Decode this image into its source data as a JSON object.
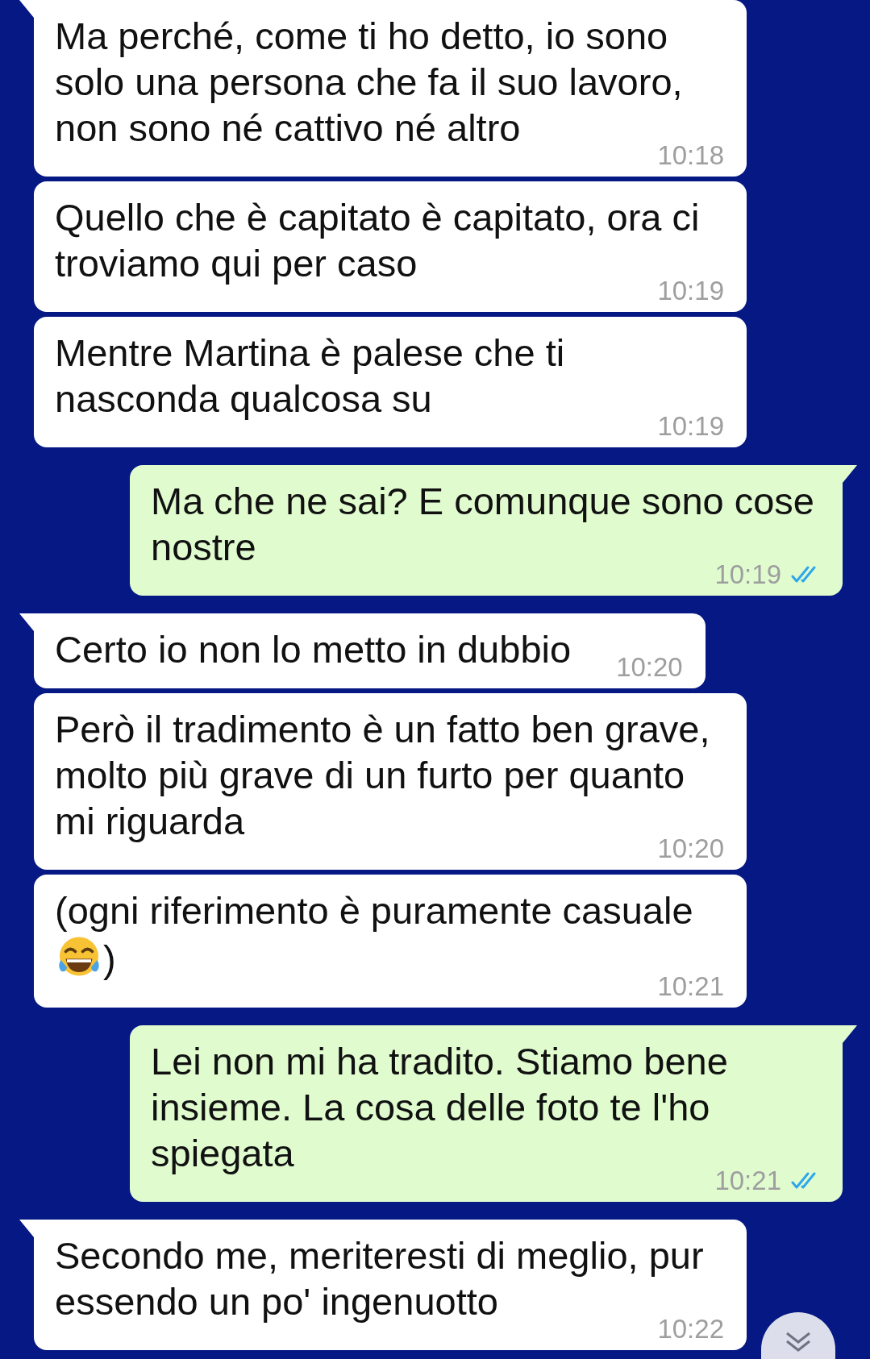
{
  "messages": [
    {
      "kind": "incoming",
      "tail": true,
      "parts": [
        {
          "kind": "text",
          "text": "Ma perché, come ti ho detto, io sono solo una persona che fa il suo lavoro, non sono né cattivo né altro"
        }
      ],
      "time": "10:18"
    },
    {
      "kind": "incoming",
      "tail": false,
      "parts": [
        {
          "kind": "text",
          "text": "Quello che è capitato è capitato, ora ci troviamo qui per caso"
        }
      ],
      "time": "10:19"
    },
    {
      "kind": "incoming",
      "tail": false,
      "parts": [
        {
          "kind": "text",
          "text": "Mentre Martina è palese che ti nasconda qualcosa su"
        }
      ],
      "time": "10:19"
    },
    {
      "kind": "outgoing",
      "tail": true,
      "parts": [
        {
          "kind": "text",
          "text": "Ma che ne sai? E comunque sono cose nostre"
        }
      ],
      "time": "10:19",
      "read": true
    },
    {
      "kind": "incoming",
      "tail": true,
      "parts": [
        {
          "kind": "text",
          "text": "Certo io non lo metto in dubbio"
        }
      ],
      "time": "10:20"
    },
    {
      "kind": "incoming",
      "tail": false,
      "parts": [
        {
          "kind": "text",
          "text": "Però il tradimento è un fatto ben grave, molto più grave di un furto per quanto mi riguarda"
        }
      ],
      "time": "10:20"
    },
    {
      "kind": "incoming",
      "tail": false,
      "parts": [
        {
          "kind": "text",
          "text": "(ogni riferimento è puramente casuale "
        },
        {
          "kind": "emoji"
        },
        {
          "kind": "text",
          "text": ")"
        }
      ],
      "time": "10:21"
    },
    {
      "kind": "outgoing",
      "tail": true,
      "parts": [
        {
          "kind": "text",
          "text": "Lei non mi ha tradito. Stiamo bene insieme. La cosa delle foto te l'ho spiegata"
        }
      ],
      "time": "10:21",
      "read": true
    },
    {
      "kind": "incoming",
      "tail": true,
      "parts": [
        {
          "kind": "text",
          "text": "Secondo me, meriteresti di meglio, pur essendo un po' ingenuotto"
        }
      ],
      "time": "10:22"
    }
  ],
  "scroll_button": {
    "kind": "scroll-down"
  }
}
